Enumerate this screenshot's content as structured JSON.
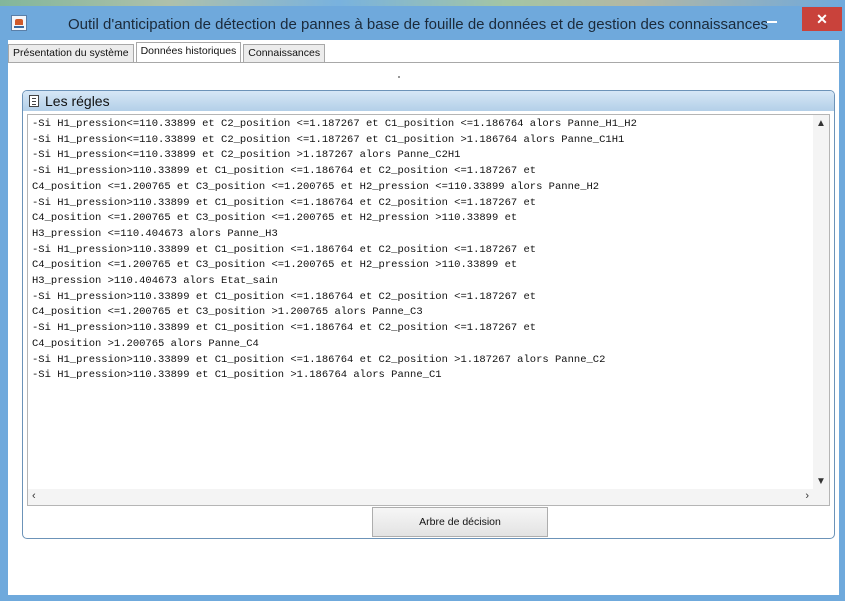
{
  "window": {
    "title": "Outil d'anticipation de détection de pannes à base de fouille de données et de gestion des connaissances",
    "close_label": "✕"
  },
  "tabs": [
    {
      "label": "Présentation du système",
      "active": false
    },
    {
      "label": "Données historiques",
      "active": true
    },
    {
      "label": "Connaissances",
      "active": false
    }
  ],
  "panel": {
    "title": "Les régles",
    "lines": [
      "-Si H1_pression<=110.33899 et C2_position <=1.187267 et C1_position <=1.186764 alors Panne_H1_H2",
      "-Si H1_pression<=110.33899 et C2_position <=1.187267 et C1_position >1.186764 alors Panne_C1H1",
      "-Si H1_pression<=110.33899 et C2_position >1.187267 alors Panne_C2H1",
      "-Si H1_pression>110.33899 et C1_position <=1.186764 et C2_position <=1.187267 et",
      "C4_position <=1.200765 et C3_position <=1.200765 et H2_pression <=110.33899 alors Panne_H2",
      "-Si H1_pression>110.33899 et C1_position <=1.186764 et C2_position <=1.187267 et",
      "C4_position <=1.200765 et C3_position <=1.200765 et H2_pression >110.33899 et",
      "H3_pression <=110.404673 alors Panne_H3",
      "-Si H1_pression>110.33899 et C1_position <=1.186764 et C2_position <=1.187267 et",
      "C4_position <=1.200765 et C3_position <=1.200765 et H2_pression >110.33899 et",
      "H3_pression >110.404673 alors Etat_sain",
      "-Si H1_pression>110.33899 et C1_position <=1.186764 et C2_position <=1.187267 et",
      "C4_position <=1.200765 et C3_position >1.200765 alors Panne_C3",
      "-Si H1_pression>110.33899 et C1_position <=1.186764 et C2_position <=1.187267 et",
      "C4_position >1.200765 alors Panne_C4",
      "-Si H1_pression>110.33899 et C1_position <=1.186764 et C2_position >1.187267 alors Panne_C2",
      "-Si H1_pression>110.33899 et C1_position >1.186764 alors Panne_C1"
    ]
  },
  "buttons": {
    "decision_tree": "Arbre de décision"
  },
  "colors": {
    "window_frame": "#6fa9dc",
    "close_button": "#c9423b",
    "panel_header": "#c5dcf0"
  }
}
